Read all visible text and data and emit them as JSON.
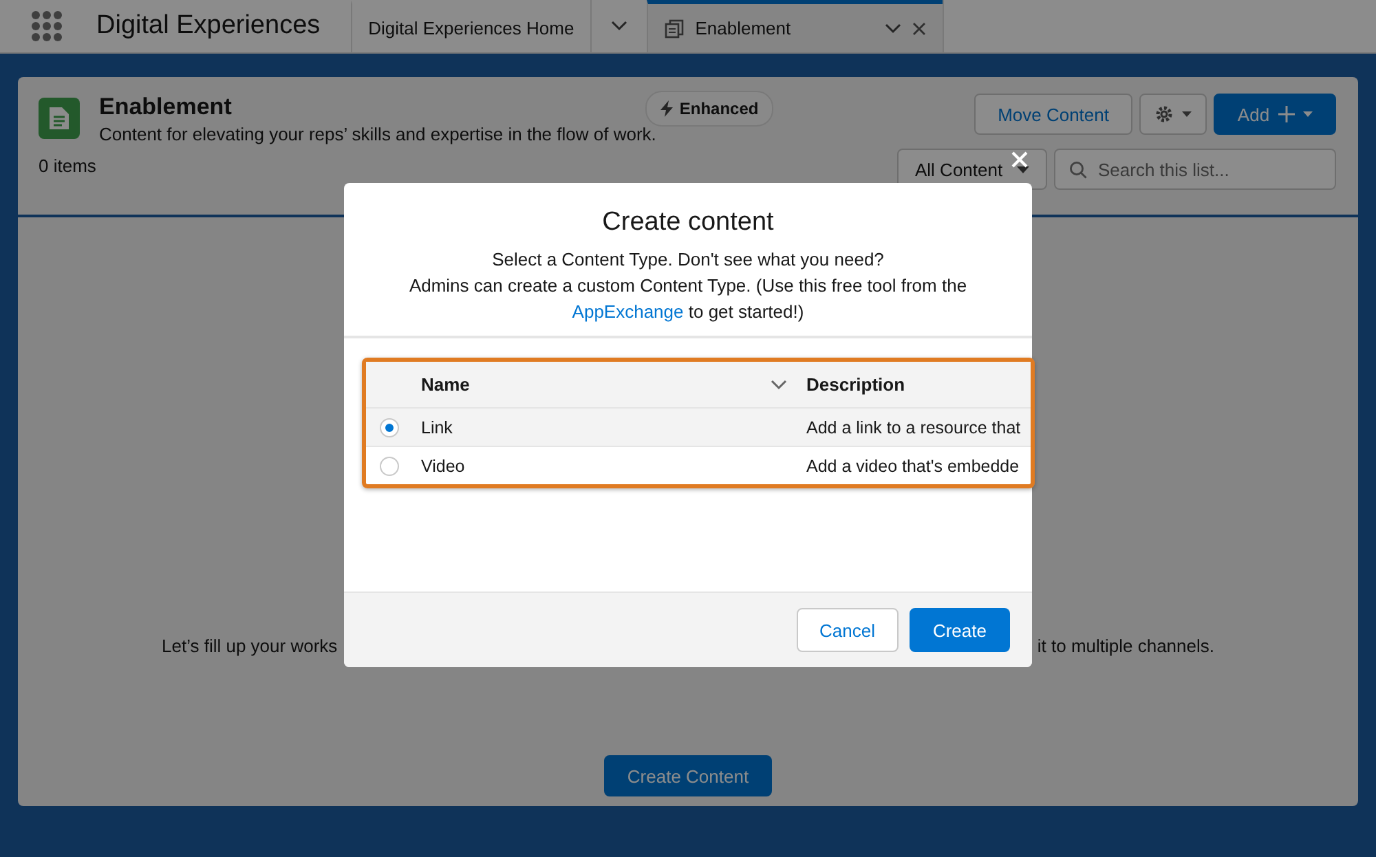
{
  "app_name": "Digital Experiences",
  "tabs": [
    {
      "label": "Digital Experiences Home",
      "selected": false,
      "closable": false
    },
    {
      "label": "Enablement",
      "selected": true,
      "closable": true
    }
  ],
  "page_header": {
    "title": "Enablement",
    "subtitle": "Content for elevating your reps’ skills and expertise in the flow of work.",
    "badge": "Enhanced",
    "count": "0 items",
    "move_button": "Move Content",
    "add_button": "Add",
    "filter": "All Content",
    "search": {
      "placeholder": "Search this list..."
    }
  },
  "empty_state": {
    "message_start": "Let’s fill up your works",
    "message_end": "it to multiple channels.",
    "button": "Create Content"
  },
  "modal": {
    "title": "Create content",
    "intro": "Select a Content Type. Don't see what you need?",
    "text_before": "Admins can create a custom Content Type. (Use this free tool from the",
    "link": "AppExchange",
    "text_after": "to get started!)",
    "table": {
      "columns": [
        {
          "label": "Name",
          "sortable": true
        },
        {
          "label": "Description",
          "sortable": false
        }
      ],
      "rows": [
        {
          "name": "Link",
          "description": "Add a link to a resource that",
          "selected": true
        },
        {
          "name": "Video",
          "description": "Add a video that's embedde",
          "selected": false
        }
      ]
    },
    "buttons": [
      {
        "label": "Cancel",
        "kind": "neutral"
      },
      {
        "label": "Create",
        "kind": "brand"
      }
    ]
  }
}
